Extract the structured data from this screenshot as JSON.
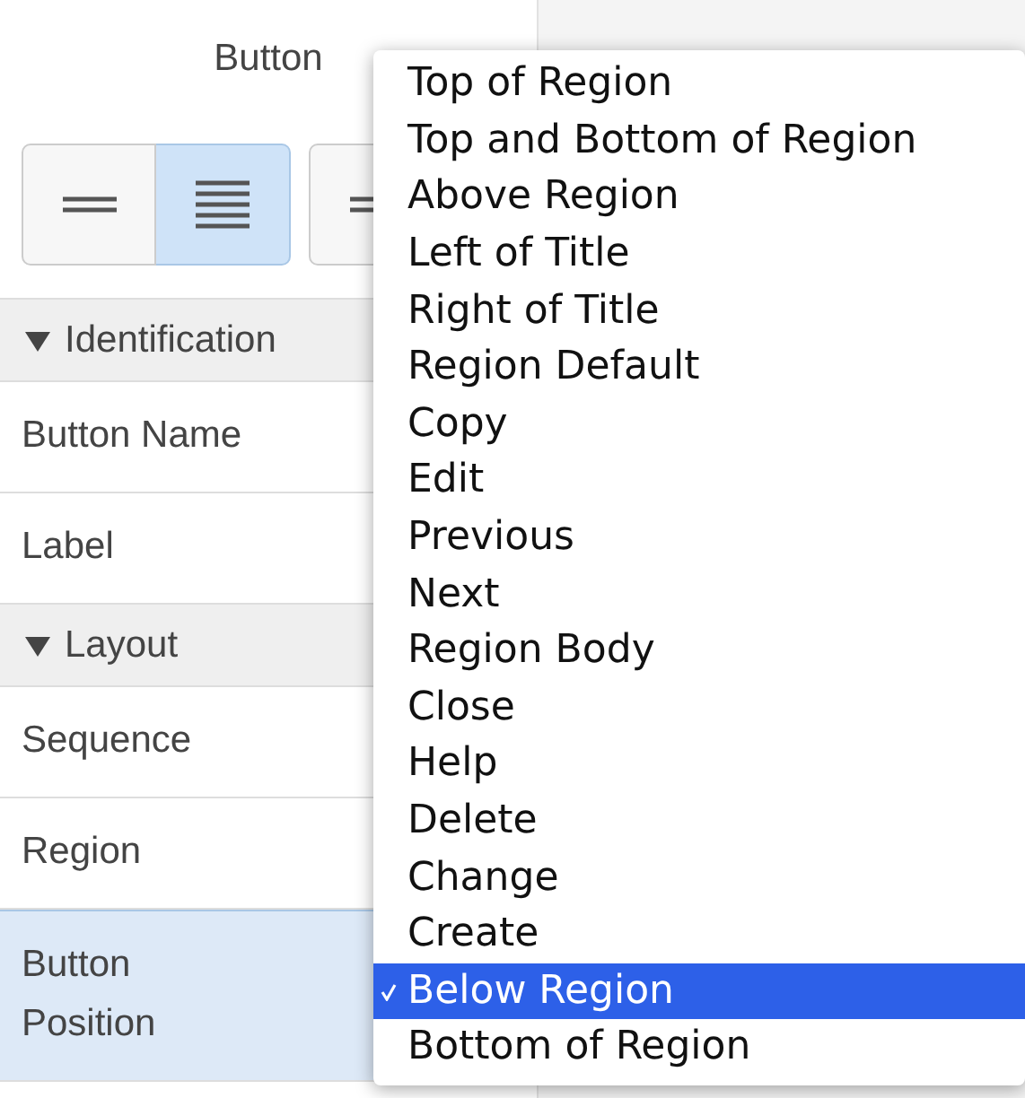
{
  "panel": {
    "title": "Button",
    "align_buttons": [
      {
        "kind": "two-lines",
        "selected": false
      },
      {
        "kind": "four-lines",
        "selected": true
      },
      {
        "kind": "wrap",
        "selected": false
      }
    ],
    "sections": [
      {
        "title": "Identification",
        "expanded": true,
        "rows": [
          {
            "label": "Button Name",
            "selected": false
          },
          {
            "label": "Label",
            "selected": false
          }
        ]
      },
      {
        "title": "Layout",
        "expanded": true,
        "rows": [
          {
            "label": "Sequence",
            "selected": false
          },
          {
            "label": "Region",
            "selected": false
          },
          {
            "label": "Button Position",
            "selected": true
          }
        ]
      }
    ]
  },
  "menu": {
    "items": [
      {
        "label": "Top of Region",
        "selected": false
      },
      {
        "label": "Top and Bottom of Region",
        "selected": false
      },
      {
        "label": "Above Region",
        "selected": false
      },
      {
        "label": "Left of Title",
        "selected": false
      },
      {
        "label": "Right of Title",
        "selected": false
      },
      {
        "label": "Region Default",
        "selected": false
      },
      {
        "label": "Copy",
        "selected": false
      },
      {
        "label": "Edit",
        "selected": false
      },
      {
        "label": "Previous",
        "selected": false
      },
      {
        "label": "Next",
        "selected": false
      },
      {
        "label": "Region Body",
        "selected": false
      },
      {
        "label": "Close",
        "selected": false
      },
      {
        "label": "Help",
        "selected": false
      },
      {
        "label": "Delete",
        "selected": false
      },
      {
        "label": "Change",
        "selected": false
      },
      {
        "label": "Create",
        "selected": false
      },
      {
        "label": "Below Region",
        "selected": true
      },
      {
        "label": "Bottom of Region",
        "selected": false
      }
    ]
  }
}
